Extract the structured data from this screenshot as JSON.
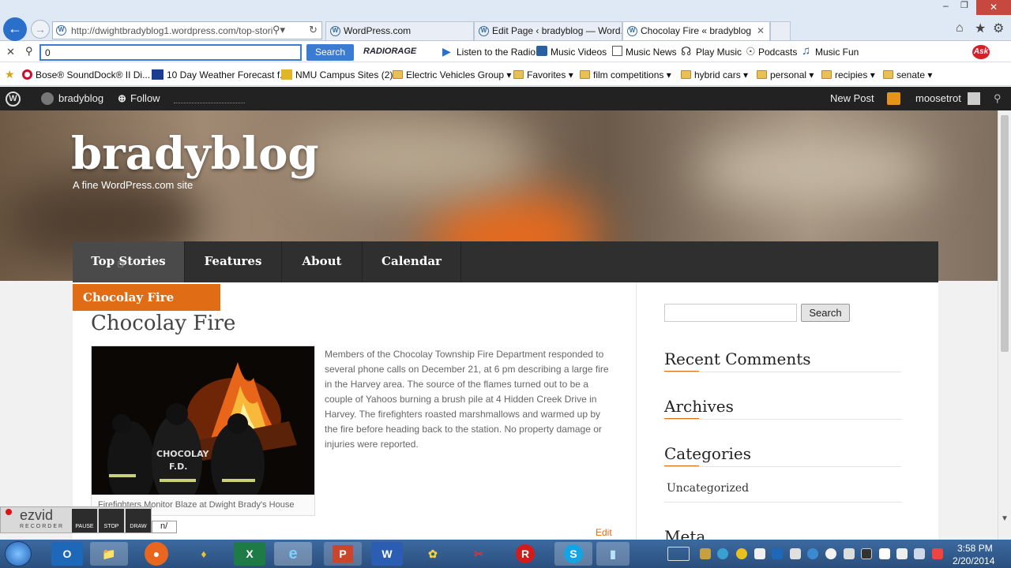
{
  "browser": {
    "address": "http://dwightbradyblog1.wordpress.com/top-stori",
    "tabs": [
      {
        "title": "WordPress.com"
      },
      {
        "title": "Edit Page ‹ bradyblog — Word..."
      },
      {
        "title": "Chocolay Fire « bradyblog"
      }
    ],
    "toolbar": {
      "search_value": "0",
      "search_button": "Search",
      "radiorage": "RADIORAGE",
      "listen": "Listen to the Radio",
      "music_videos": "Music Videos",
      "music_news": "Music News",
      "play_music": "Play Music",
      "podcasts": "Podcasts",
      "music_fun": "Music Fun",
      "ask": "Ask"
    },
    "favorites": [
      "Bose® SoundDock® II Di...",
      "10 Day Weather Forecast f...",
      "NMU  Campus Sites (2)",
      "Electric Vehicles Group",
      "Favorites",
      "film competitions",
      "hybrid cars",
      "personal",
      "recipies",
      "senate"
    ]
  },
  "wpbar": {
    "site": "bradyblog",
    "follow": "Follow",
    "new_post": "New Post",
    "user": "moosetrot"
  },
  "site": {
    "title": "bradyblog",
    "tagline": "A fine WordPress.com site"
  },
  "nav": [
    "Top Stories",
    "Features",
    "About",
    "Calendar"
  ],
  "post": {
    "category_label": "Chocolay Fire",
    "title": "Chocolay Fire",
    "body": "Members of the Chocolay Township Fire Department responded to several phone calls on December 21, at 6 pm describing a large fire in the Harvey area. The source of the flames turned out to be a couple of Yahoos burning a brush pile at 4 Hidden Creek Drive in Harvey. The firefighters roasted marshmallows and warmed up by the fire before heading back to the station. No property damage or injuries were reported.",
    "caption": "Firefighters Monitor Blaze at Dwight Brady's House",
    "edit": "Edit",
    "jacket_text": [
      "CHOCOLAY",
      "F.D."
    ]
  },
  "sidebar": {
    "search_button": "Search",
    "recent_comments": "Recent Comments",
    "archives": "Archives",
    "categories": "Categories",
    "category_item": "Uncategorized",
    "meta": "Meta"
  },
  "recorder": {
    "brand": "ezvid",
    "sub": "RECORDER",
    "pause": "PAUSE",
    "stop": "STOP",
    "draw": "DRAW",
    "url_tip": "n/"
  },
  "taskbar": {
    "time": "3:58 PM",
    "date": "2/20/2014"
  },
  "colors": {
    "accent": "#e06c15",
    "nav_bg": "#2f2f2f",
    "wpbar_bg": "#222222",
    "ie_blue": "#1e5fb4"
  }
}
